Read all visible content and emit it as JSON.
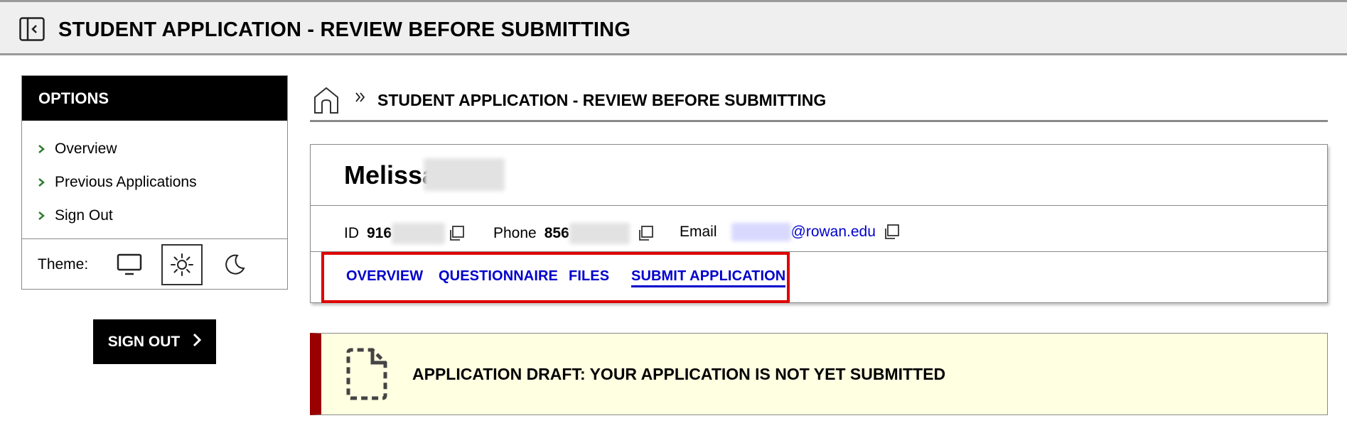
{
  "header": {
    "title": "STUDENT APPLICATION - REVIEW BEFORE SUBMITTING",
    "toggle_icon": "panel-collapse-icon"
  },
  "options": {
    "title": "OPTIONS",
    "items": [
      {
        "label": "Overview"
      },
      {
        "label": "Previous Applications"
      },
      {
        "label": "Sign Out"
      }
    ],
    "theme_label": "Theme:",
    "themes": [
      {
        "icon": "monitor-icon",
        "selected": false
      },
      {
        "icon": "sun-icon",
        "selected": true
      },
      {
        "icon": "moon-icon",
        "selected": false
      }
    ]
  },
  "signout_button": {
    "label": "SIGN OUT"
  },
  "breadcrumb": {
    "current": "STUDENT APPLICATION - REVIEW BEFORE SUBMITTING"
  },
  "profile": {
    "first_name": "Melissa",
    "id_label": "ID",
    "id_value": "916",
    "phone_label": "Phone",
    "phone_value": "856",
    "email_label": "Email",
    "email_domain": "@rowan.edu"
  },
  "tabs": [
    {
      "label": "OVERVIEW",
      "active": false
    },
    {
      "label": "QUESTIONNAIRE",
      "active": false
    },
    {
      "label": "FILES",
      "active": false
    },
    {
      "label": "SUBMIT APPLICATION",
      "active": true
    }
  ],
  "banner": {
    "message": "APPLICATION DRAFT: YOUR APPLICATION IS NOT YET SUBMITTED"
  },
  "colors": {
    "link": "#0000cc",
    "highlight": "#e00000",
    "banner_accent": "#9b0000",
    "banner_bg": "#ffffe2",
    "chevron": "#2e7d32"
  }
}
